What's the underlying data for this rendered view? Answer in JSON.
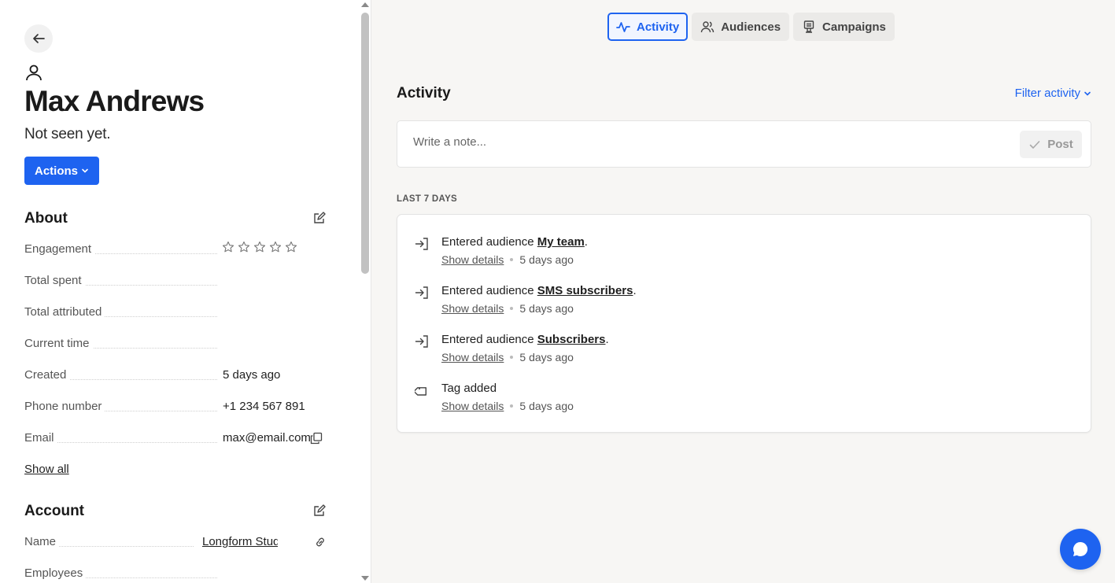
{
  "profile": {
    "name": "Max Andrews",
    "status": "Not seen yet.",
    "actions_label": "Actions"
  },
  "about": {
    "title": "About",
    "engagement_label": "Engagement",
    "engagement_rating": 0,
    "engagement_max": 5,
    "rows": [
      {
        "label": "Total spent",
        "value": ""
      },
      {
        "label": "Total attributed",
        "value": ""
      },
      {
        "label": "Current time",
        "value": ""
      },
      {
        "label": "Created",
        "value": "5 days ago"
      },
      {
        "label": "Phone number",
        "value": "+1 234 567 891"
      },
      {
        "label": "Email",
        "value": "max@email.com"
      }
    ],
    "show_all": "Show all"
  },
  "account": {
    "title": "Account",
    "name_label": "Name",
    "name_value": "Longform Stud",
    "employees_label": "Employees"
  },
  "tabs": [
    {
      "label": "Activity",
      "icon": "activity-pulse-icon",
      "active": true
    },
    {
      "label": "Audiences",
      "icon": "users-icon",
      "active": false
    },
    {
      "label": "Campaigns",
      "icon": "campaigns-icon",
      "active": false
    }
  ],
  "activity": {
    "title": "Activity",
    "filter_label": "Filter activity",
    "note_placeholder": "Write a note...",
    "post_label": "Post",
    "period_label": "LAST 7 DAYS",
    "items": [
      {
        "icon": "enter-icon",
        "prefix": "Entered audience ",
        "link": "My team",
        "suffix": ".",
        "details": "Show details",
        "time": "5 days ago"
      },
      {
        "icon": "enter-icon",
        "prefix": "Entered audience ",
        "link": "SMS subscribers",
        "suffix": ".",
        "details": "Show details",
        "time": "5 days ago"
      },
      {
        "icon": "enter-icon",
        "prefix": "Entered audience ",
        "link": "Subscribers",
        "suffix": ".",
        "details": "Show details",
        "time": "5 days ago"
      },
      {
        "icon": "tag-icon",
        "prefix": "Tag added",
        "link": "",
        "suffix": "",
        "details": "Show details",
        "time": "5 days ago"
      }
    ]
  },
  "colors": {
    "accent": "#1e63f0",
    "panel_bg": "#f7f6f4"
  }
}
